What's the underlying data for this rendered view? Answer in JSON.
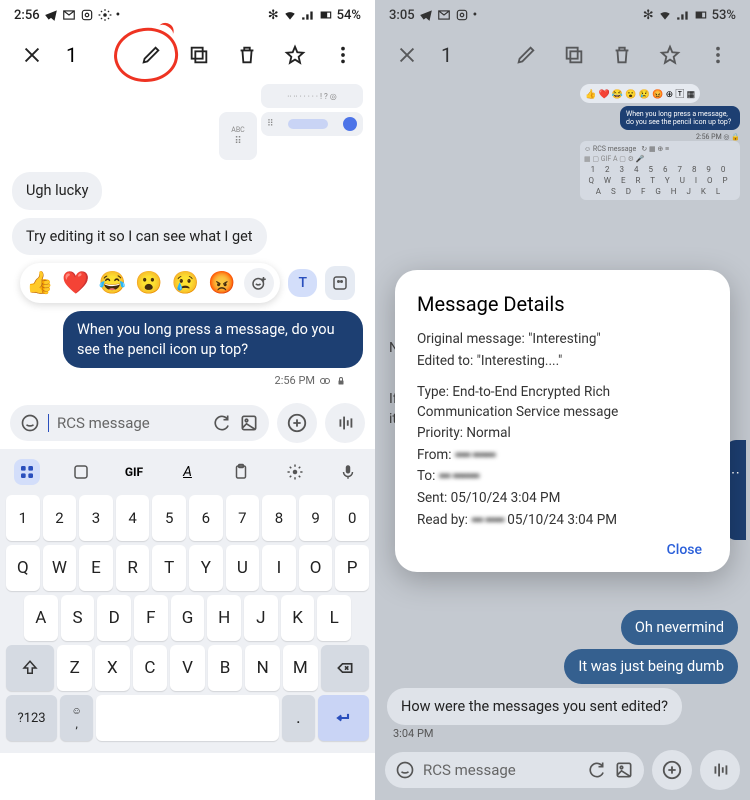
{
  "left": {
    "status": {
      "time": "2:56",
      "battery": "54%"
    },
    "selection_count": "1",
    "messages": {
      "in1": "Ugh lucky",
      "in2": "Try editing it so I can see what I get",
      "out1": "When you long press a message, do you see the pencil icon up top?",
      "ts": "2:56 PM"
    },
    "reactions": [
      "👍",
      "❤️",
      "😂",
      "😮",
      "😢",
      "😡"
    ],
    "text_tab": "T",
    "input": {
      "placeholder": "RCS message"
    },
    "keyboard": {
      "numbers": [
        "1",
        "2",
        "3",
        "4",
        "5",
        "6",
        "7",
        "8",
        "9",
        "0"
      ],
      "row1": [
        "Q",
        "W",
        "E",
        "R",
        "T",
        "Y",
        "U",
        "I",
        "O",
        "P"
      ],
      "row2": [
        "A",
        "S",
        "D",
        "F",
        "G",
        "H",
        "J",
        "K",
        "L"
      ],
      "row3": [
        "Z",
        "X",
        "C",
        "V",
        "B",
        "N",
        "M"
      ],
      "sym": "?123"
    }
  },
  "right": {
    "status": {
      "time": "3:05",
      "battery": "53%"
    },
    "selection_count": "1",
    "mini_bubble": "When you long press a message, do you see the pencil icon up top?",
    "mini_ts": "RCS message",
    "mini_kb1": "1 2 3 4 5 6 7 8 9 0",
    "mini_kb2": "Q W E R T Y U I O P",
    "mini_kb3": "A S D F G H J K L",
    "bg_no": "No",
    "bg_if": "If y",
    "bg_its": "it's",
    "modal": {
      "title": "Message Details",
      "orig": "Original message: \"Interesting\"",
      "edit": "Edited to: \"Interesting....\"",
      "type": "Type: End-to-End Encrypted Rich Communication Service message",
      "priority": "Priority: Normal",
      "from_label": "From:",
      "from_val": "▪▪▪▪ ▪▪▪▪▪▪",
      "to_label": "To:",
      "to_val": "▪▪▪ ▪▪▪▪▪▪▪",
      "sent": "Sent: 05/10/24 3:04 PM",
      "read_label": "Read by:",
      "read_val": "▪▪▪ ▪▪▪▪▪",
      "read_ts": " 05/10/24 3:04 PM",
      "close": "Close"
    },
    "chat": {
      "out1": "Oh nevermind",
      "out2": "It was just being dumb",
      "in1": "How were the messages you sent edited?",
      "ts": "3:04 PM"
    },
    "input": {
      "placeholder": "RCS message"
    }
  }
}
